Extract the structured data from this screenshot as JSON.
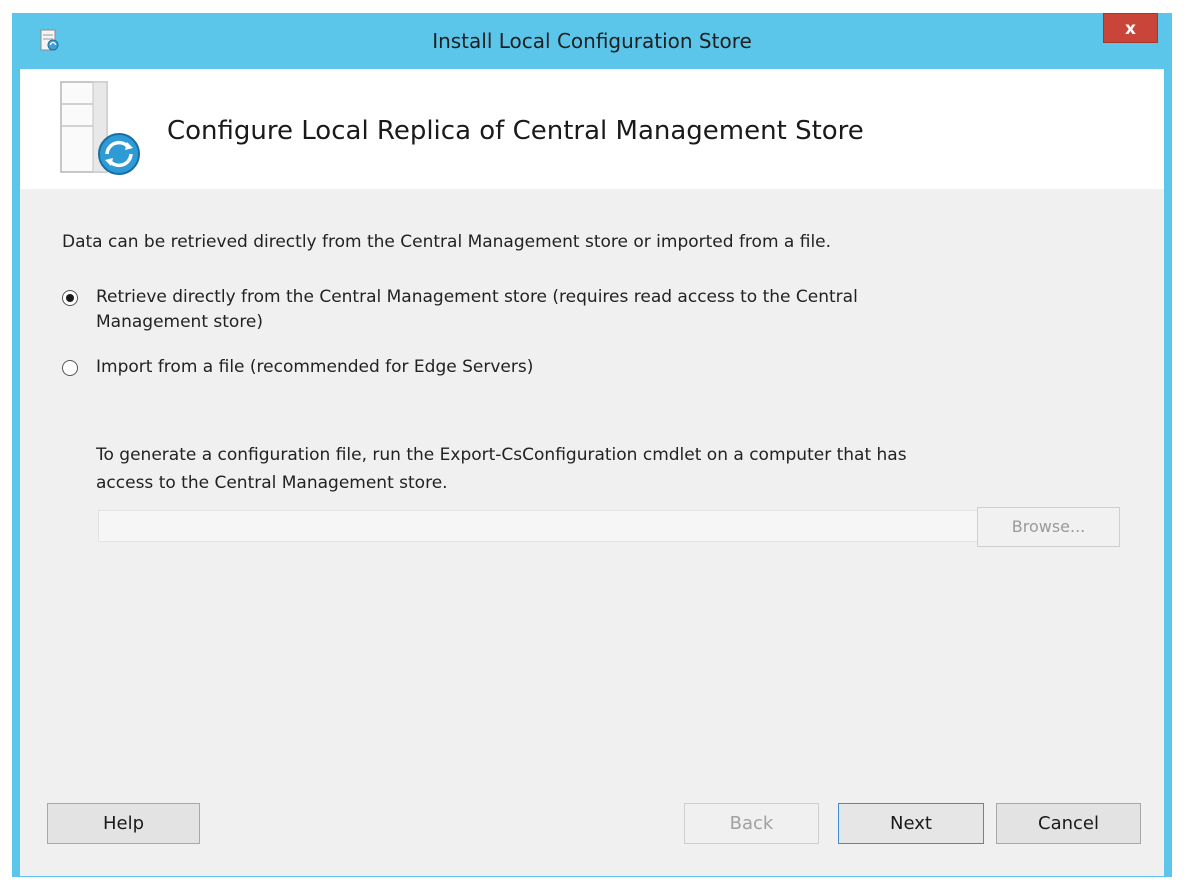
{
  "window": {
    "title": "Install Local Configuration Store",
    "close_label": "x"
  },
  "header": {
    "title": "Configure Local Replica of Central Management Store"
  },
  "body": {
    "intro": "Data can be retrieved directly from the Central Management store or imported from a file.",
    "option_retrieve_line1": "Retrieve directly from the Central Management store (requires read access to the Central",
    "option_retrieve_line2": "Management store)",
    "option_import": "Import from a file (recommended for Edge Servers)",
    "help_line1": "To generate a configuration file, run the Export-CsConfiguration cmdlet on a computer that has",
    "help_line2": "access to the Central Management store.",
    "file_path_value": "",
    "browse_label": "Browse..."
  },
  "footer": {
    "help_label": "Help",
    "back_label": "Back",
    "next_label": "Next",
    "cancel_label": "Cancel"
  },
  "selected_option": "retrieve",
  "colors": {
    "window_frame": "#5bc6ea",
    "close_button": "#c9453a",
    "dialog_background": "#f0f0f0",
    "header_background": "#ffffff",
    "default_button_border": "#3c8fd6"
  }
}
